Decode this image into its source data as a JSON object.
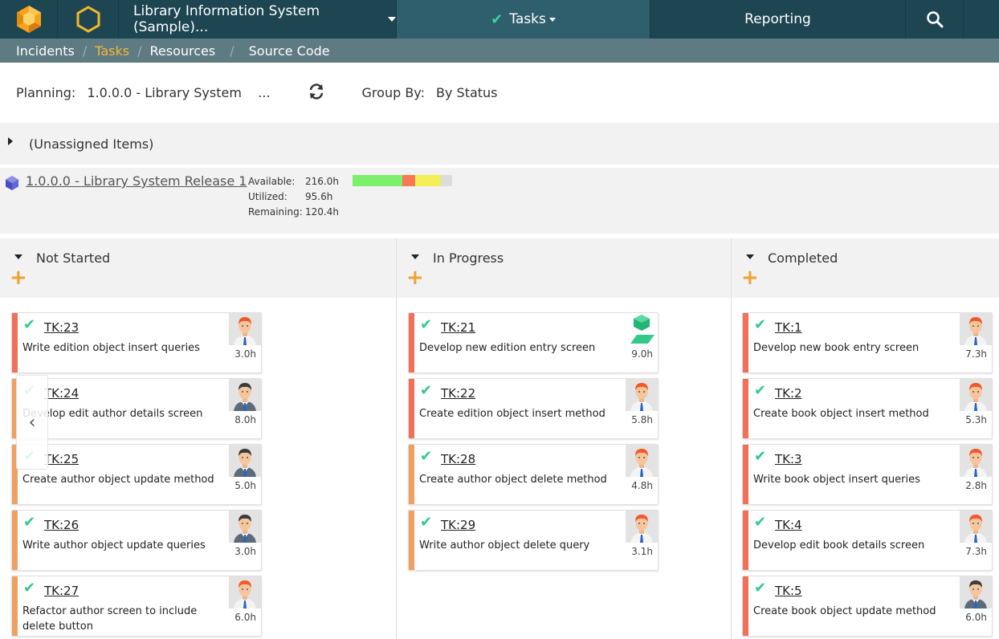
{
  "header": {
    "project": "Library Information System (Sample)...",
    "tasks_tab": "Tasks",
    "reporting": "Reporting"
  },
  "subnav": {
    "items": [
      "Incidents",
      "Tasks",
      "Resources",
      "Source Code"
    ],
    "active": "Tasks"
  },
  "planning": {
    "label": "Planning:",
    "value": "1.0.0.0 - Library System    ...",
    "group_by_label": "Group By:",
    "group_by_value": "By Status"
  },
  "unassigned": "(Unassigned Items)",
  "release": {
    "name": "1.0.0.0 - Library System Release 1",
    "available_label": "Available:",
    "available": "216.0h",
    "utilized_label": "Utilized:",
    "utilized": "95.6h",
    "remaining_label": "Remaining:",
    "remaining": "120.4h",
    "capacity_segments": [
      {
        "color": "#7cf06a",
        "fraction": 0.5
      },
      {
        "color": "#f57a55",
        "fraction": 0.13
      },
      {
        "color": "#f2ee55",
        "fraction": 0.26
      },
      {
        "color": "#dcdcdc",
        "fraction": 0.11
      }
    ]
  },
  "columns": [
    {
      "title": "Not Started",
      "cards": [
        {
          "id": "TK:23",
          "desc": "Write edition object insert queries",
          "hours": "3.0h",
          "stripe": "#f0705a",
          "avatar": "red"
        },
        {
          "id": "TK:24",
          "desc": "Develop edit author details screen",
          "hours": "8.0h",
          "stripe": "#f0a060",
          "avatar": "dark"
        },
        {
          "id": "TK:25",
          "desc": "Create author object update method",
          "hours": "5.0h",
          "stripe": "#f0a060",
          "avatar": "dark"
        },
        {
          "id": "TK:26",
          "desc": "Write author object update queries",
          "hours": "3.0h",
          "stripe": "#f0a060",
          "avatar": "dark"
        },
        {
          "id": "TK:27",
          "desc": "Refactor author screen to include delete button",
          "hours": "6.0h",
          "stripe": "#f0a060",
          "avatar": "red"
        }
      ]
    },
    {
      "title": "In Progress",
      "cards": [
        {
          "id": "TK:21",
          "desc": "Develop new edition entry screen",
          "hours": "9.0h",
          "stripe": "#f0705a",
          "avatar": "component"
        },
        {
          "id": "TK:22",
          "desc": "Create edition object insert method",
          "hours": "5.8h",
          "stripe": "#f0705a",
          "avatar": "red"
        },
        {
          "id": "TK:28",
          "desc": "Create author object delete method",
          "hours": "4.8h",
          "stripe": "#f0a060",
          "avatar": "red"
        },
        {
          "id": "TK:29",
          "desc": "Write author object delete query",
          "hours": "3.1h",
          "stripe": "#f0a060",
          "avatar": "red"
        }
      ]
    },
    {
      "title": "Completed",
      "cards": [
        {
          "id": "TK:1",
          "desc": "Develop new book entry screen",
          "hours": "7.3h",
          "stripe": "#f0705a",
          "avatar": "red"
        },
        {
          "id": "TK:2",
          "desc": "Create book object insert method",
          "hours": "5.3h",
          "stripe": "#f0705a",
          "avatar": "red"
        },
        {
          "id": "TK:3",
          "desc": "Write book object insert queries",
          "hours": "2.8h",
          "stripe": "#f0705a",
          "avatar": "red"
        },
        {
          "id": "TK:4",
          "desc": "Develop edit book details screen",
          "hours": "7.3h",
          "stripe": "#f0705a",
          "avatar": "red"
        },
        {
          "id": "TK:5",
          "desc": "Create book object update method",
          "hours": "6.0h",
          "stripe": "#f0705a",
          "avatar": "dark"
        }
      ]
    }
  ]
}
